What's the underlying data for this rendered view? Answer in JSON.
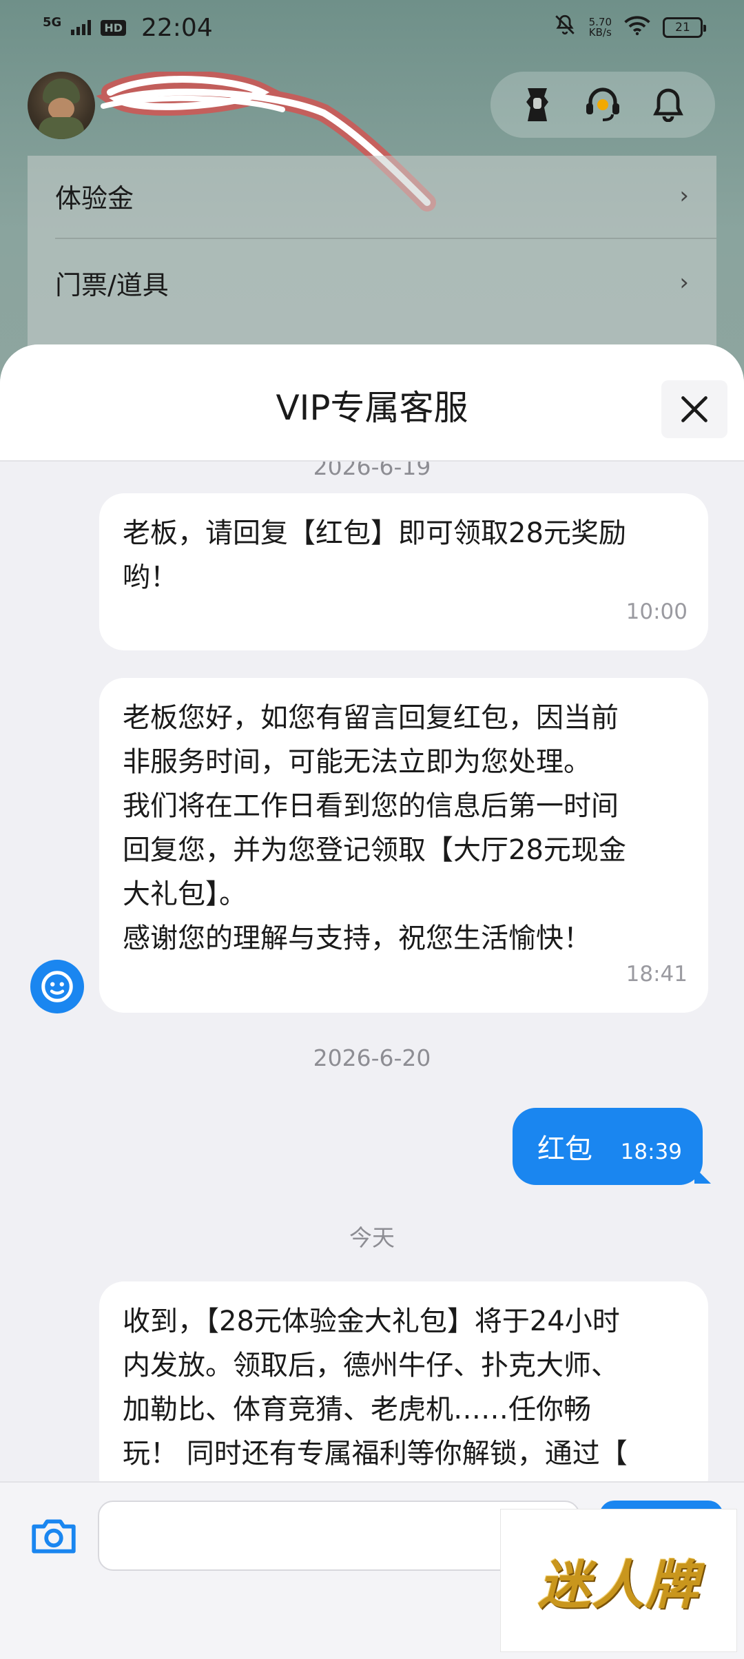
{
  "status_bar": {
    "network": "5G",
    "hd": "HD",
    "time": "22:04",
    "speed_value": "5.70",
    "speed_unit": "KB/s",
    "battery": "21"
  },
  "background": {
    "menu_items": [
      {
        "label": "体验金"
      },
      {
        "label": "门票/道具"
      }
    ],
    "icons": [
      "vip-badge-icon",
      "customer-service-icon",
      "bell-icon"
    ]
  },
  "sheet": {
    "title": "VIP专属客服"
  },
  "chat": {
    "date_top": "2026-6-19",
    "messages": [
      {
        "text": "老板，请回复【红包】即可领取28元奖励\n哟！",
        "time": "10:00"
      },
      {
        "text": "老板您好，如您有留言回复红包，因当前\n非服务时间，可能无法立即为您处理。\n我们将在工作日看到您的信息后第一时间\n回复您，并为您登记领取【大厅28元现金\n大礼包】。\n感谢您的理解与支持，祝您生活愉快！",
        "time": "18:41"
      }
    ],
    "date_mid": "2026-6-20",
    "outgoing": {
      "text": "红包",
      "time": "18:39"
    },
    "date_today": "今天",
    "last_message": {
      "text": "收到，【28元体验金大礼包】将于24小时\n内发放。领取后，德州牛仔、扑克大师、\n加勒比、体育竞猜、老虎机……任你畅\n玩！ 同时还有专属福利等你解锁，通过【"
    }
  },
  "composer": {
    "placeholder": ""
  },
  "watermark": "迷人牌",
  "colors": {
    "accent": "#1a86f0",
    "sheet_bg": "#f0f0f4"
  }
}
